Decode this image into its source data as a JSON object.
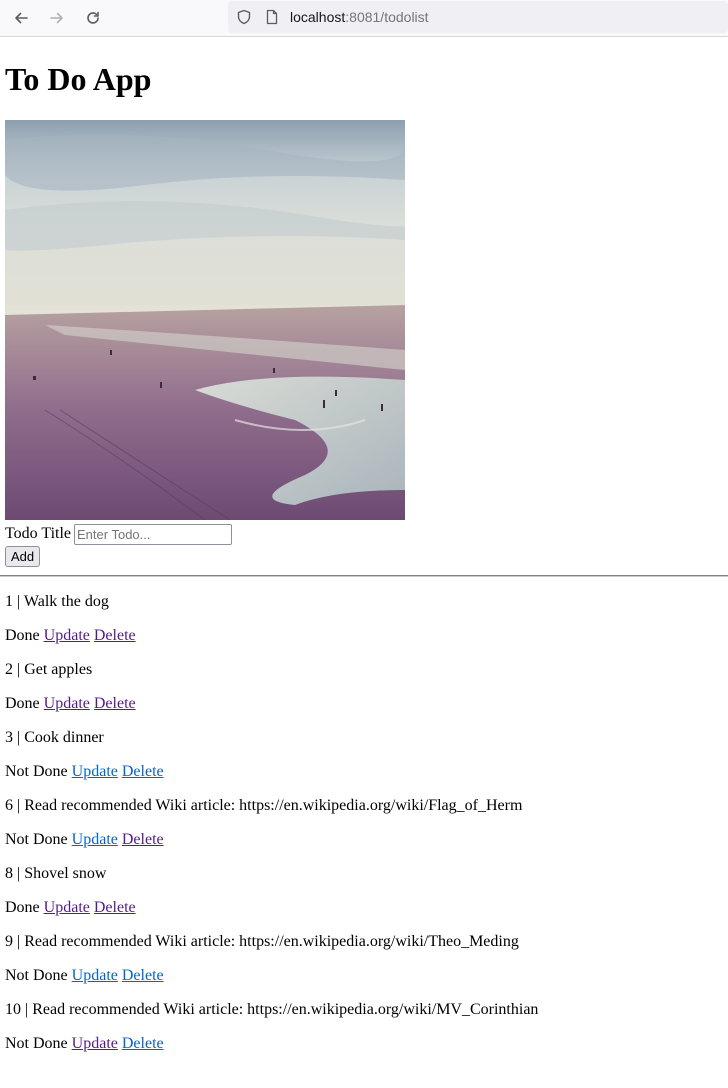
{
  "browser": {
    "url_host": "localhost",
    "url_rest": ":8081/todolist"
  },
  "page": {
    "title": "To Do App"
  },
  "form": {
    "label": "Todo Title",
    "placeholder": "Enter Todo...",
    "add_label": "Add"
  },
  "todos": [
    {
      "id": "1",
      "title": "Walk the dog",
      "status": "Done"
    },
    {
      "id": "2",
      "title": "Get apples",
      "status": "Done"
    },
    {
      "id": "3",
      "title": "Cook dinner",
      "status": "Not Done"
    },
    {
      "id": "6",
      "title": "Read recommended Wiki article: https://en.wikipedia.org/wiki/Flag_of_Herm",
      "status": "Not Done"
    },
    {
      "id": "8",
      "title": "Shovel snow",
      "status": "Done"
    },
    {
      "id": "9",
      "title": "Read recommended Wiki article: https://en.wikipedia.org/wiki/Theo_Meding",
      "status": "Not Done"
    },
    {
      "id": "10",
      "title": "Read recommended Wiki article: https://en.wikipedia.org/wiki/MV_Corinthian",
      "status": "Not Done"
    }
  ],
  "actions": {
    "update_label": "Update",
    "delete_label": "Delete",
    "separator": " | "
  },
  "colors": {
    "visited_link": "#551a8b",
    "link": "#0066cc"
  }
}
